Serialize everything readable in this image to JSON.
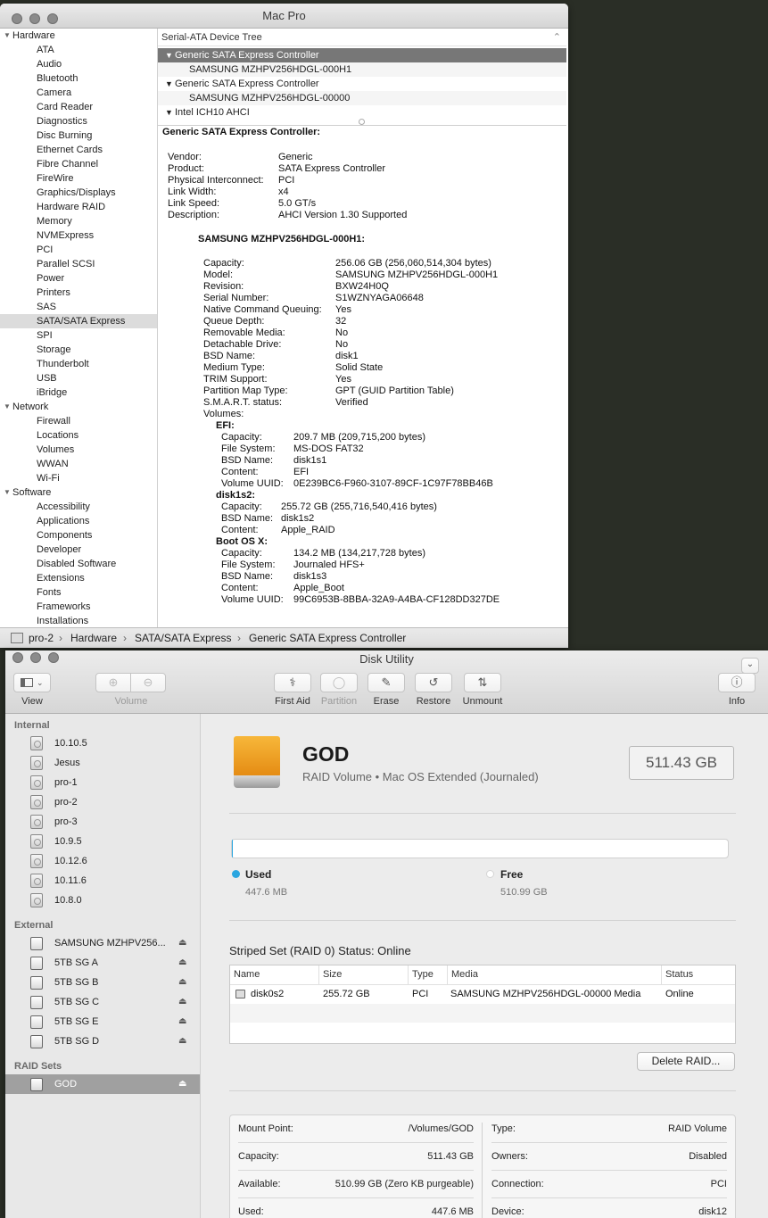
{
  "sysinfo": {
    "title": "Mac Pro",
    "sidebar": {
      "groups": [
        {
          "label": "Hardware",
          "items": [
            "ATA",
            "Audio",
            "Bluetooth",
            "Camera",
            "Card Reader",
            "Diagnostics",
            "Disc Burning",
            "Ethernet Cards",
            "Fibre Channel",
            "FireWire",
            "Graphics/Displays",
            "Hardware RAID",
            "Memory",
            "NVMExpress",
            "PCI",
            "Parallel SCSI",
            "Power",
            "Printers",
            "SAS",
            "SATA/SATA Express",
            "SPI",
            "Storage",
            "Thunderbolt",
            "USB",
            "iBridge"
          ]
        },
        {
          "label": "Network",
          "items": [
            "Firewall",
            "Locations",
            "Volumes",
            "WWAN",
            "Wi-Fi"
          ]
        },
        {
          "label": "Software",
          "items": [
            "Accessibility",
            "Applications",
            "Components",
            "Developer",
            "Disabled Software",
            "Extensions",
            "Fonts",
            "Frameworks",
            "Installations"
          ]
        }
      ],
      "selected": "SATA/SATA Express"
    },
    "tree": {
      "header": "Serial-ATA Device Tree",
      "rows": [
        {
          "label": "Generic SATA Express Controller",
          "level": 0,
          "expanded": true
        },
        {
          "label": "SAMSUNG MZHPV256HDGL-000H1",
          "level": 1
        },
        {
          "label": "Generic SATA Express Controller",
          "level": 0,
          "expanded": true
        },
        {
          "label": "SAMSUNG MZHPV256HDGL-00000",
          "level": 1
        },
        {
          "label": "Intel ICH10 AHCI",
          "level": 0,
          "expanded": true
        }
      ]
    },
    "detail": {
      "heading": "Generic SATA Express Controller:",
      "controller": [
        [
          "Vendor:",
          "Generic"
        ],
        [
          "Product:",
          "SATA Express Controller"
        ],
        [
          "Physical Interconnect:",
          "PCI"
        ],
        [
          "Link Width:",
          "x4"
        ],
        [
          "Link Speed:",
          "5.0 GT/s"
        ],
        [
          "Description:",
          "AHCI Version 1.30 Supported"
        ]
      ],
      "device_heading": "SAMSUNG MZHPV256HDGL-000H1:",
      "device": [
        [
          "Capacity:",
          "256.06 GB (256,060,514,304 bytes)"
        ],
        [
          "Model:",
          "SAMSUNG MZHPV256HDGL-000H1"
        ],
        [
          "Revision:",
          "BXW24H0Q"
        ],
        [
          "Serial Number:",
          "S1WZNYAGA06648"
        ],
        [
          "Native Command Queuing:",
          "Yes"
        ],
        [
          "Queue Depth:",
          "32"
        ],
        [
          "Removable Media:",
          "No"
        ],
        [
          "Detachable Drive:",
          "No"
        ],
        [
          "BSD Name:",
          "disk1"
        ],
        [
          "Medium Type:",
          "Solid State"
        ],
        [
          "TRIM Support:",
          "Yes"
        ],
        [
          "Partition Map Type:",
          "GPT (GUID Partition Table)"
        ],
        [
          "S.M.A.R.T. status:",
          "Verified"
        ]
      ],
      "volumes_label": "Volumes:",
      "volumes": [
        {
          "name": "EFI:",
          "props": [
            [
              "Capacity:",
              "209.7 MB (209,715,200 bytes)"
            ],
            [
              "File System:",
              "MS-DOS FAT32"
            ],
            [
              "BSD Name:",
              "disk1s1"
            ],
            [
              "Content:",
              "EFI"
            ],
            [
              "Volume UUID:",
              "0E239BC6-F960-3107-89CF-1C97F78BB46B"
            ]
          ]
        },
        {
          "name": "disk1s2:",
          "props": [
            [
              "Capacity:",
              "255.72 GB (255,716,540,416 bytes)"
            ],
            [
              "BSD Name:",
              "disk1s2"
            ],
            [
              "Content:",
              "Apple_RAID"
            ]
          ]
        },
        {
          "name": "Boot OS X:",
          "props": [
            [
              "Capacity:",
              "134.2 MB (134,217,728 bytes)"
            ],
            [
              "File System:",
              "Journaled HFS+"
            ],
            [
              "BSD Name:",
              "disk1s3"
            ],
            [
              "Content:",
              "Apple_Boot"
            ],
            [
              "Volume UUID:",
              "99C6953B-8BBA-32A9-A4BA-CF128DD327DE"
            ]
          ]
        }
      ]
    },
    "statusbar": [
      "pro-2",
      "Hardware",
      "SATA/SATA Express",
      "Generic SATA Express Controller"
    ]
  },
  "diskutility": {
    "title": "Disk Utility",
    "toolbar": {
      "view": "View",
      "volume": "Volume",
      "first_aid": "First Aid",
      "partition": "Partition",
      "erase": "Erase",
      "restore": "Restore",
      "unmount": "Unmount",
      "info": "Info"
    },
    "sidebar": {
      "internal_label": "Internal",
      "internal": [
        "10.10.5",
        "Jesus",
        "pro-1",
        "pro-2",
        "pro-3",
        "10.9.5",
        "10.12.6",
        "10.11.6",
        "10.8.0"
      ],
      "external_label": "External",
      "external": [
        "SAMSUNG MZHPV256...",
        "5TB SG A",
        "5TB SG B",
        "5TB SG C",
        "5TB SG E",
        "5TB SG D"
      ],
      "raid_label": "RAID Sets",
      "raid": [
        "GOD"
      ]
    },
    "volume": {
      "name": "GOD",
      "subtitle": "RAID Volume • Mac OS Extended (Journaled)",
      "size": "511.43 GB",
      "used_label": "Used",
      "used_value": "447.6 MB",
      "free_label": "Free",
      "free_value": "510.99 GB",
      "used_fraction": 0.0009,
      "used_color": "#2aa6e0"
    },
    "raid": {
      "status": "Striped Set (RAID 0) Status: Online",
      "columns": [
        "Name",
        "Size",
        "Type",
        "Media",
        "Status"
      ],
      "rows": [
        {
          "name": "disk0s2",
          "size": "255.72 GB",
          "type": "PCI",
          "media": "SAMSUNG MZHPV256HDGL-00000 Media",
          "status": "Online"
        }
      ],
      "delete_button": "Delete RAID..."
    },
    "info": {
      "left": [
        [
          "Mount Point:",
          "/Volumes/GOD"
        ],
        [
          "Capacity:",
          "511.43 GB"
        ],
        [
          "Available:",
          "510.99 GB (Zero KB purgeable)"
        ],
        [
          "Used:",
          "447.6 MB"
        ]
      ],
      "right": [
        [
          "Type:",
          "RAID Volume"
        ],
        [
          "Owners:",
          "Disabled"
        ],
        [
          "Connection:",
          "PCI"
        ],
        [
          "Device:",
          "disk12"
        ]
      ]
    }
  }
}
